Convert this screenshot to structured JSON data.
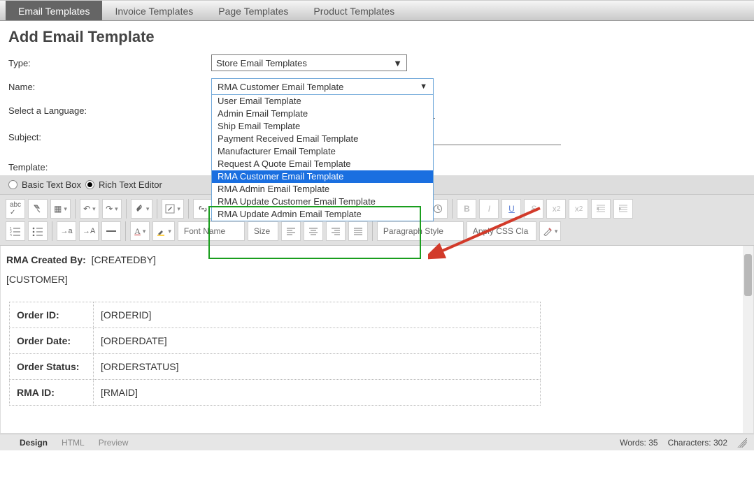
{
  "tabs": {
    "email": "Email Templates",
    "invoice": "Invoice Templates",
    "page": "Page Templates",
    "product": "Product Templates"
  },
  "page_title": "Add Email Template",
  "form": {
    "type_label": "Type:",
    "type_value": "Store Email Templates",
    "name_label": "Name:",
    "name_value": "RMA Customer Email Template",
    "name_options": [
      "User Email Template",
      "Admin Email Template",
      "Ship Email Template",
      "Payment Received Email Template",
      "Manufacturer Email Template",
      "Request A Quote Email Template",
      "RMA Customer Email Template",
      "RMA Admin Email Template",
      "RMA Update Customer Email Template",
      "RMA Update Admin Email Template"
    ],
    "lang_label": "Select a Language:",
    "lang_value": "",
    "subject_label": "Subject:",
    "subject_value": "",
    "template_label": "Template:"
  },
  "editor_mode": {
    "basic": "Basic Text Box",
    "rich": "Rich Text Editor"
  },
  "toolbar": {
    "custom_links": "Custom Links",
    "font_name": "Font Name",
    "font_size": "Size",
    "para_style": "Paragraph Style",
    "css_class": "Apply CSS Cla",
    "bold": "B",
    "italic": "I",
    "underline": "U",
    "strike": "S",
    "sup_base": "x",
    "sup_exp": "2",
    "sub_base": "x",
    "sub_exp": "2",
    "arrow_a1": "→a",
    "arrow_a2": "→A"
  },
  "editor": {
    "line1_label": "RMA Created By:",
    "line1_val": "[CREATEDBY]",
    "line2": "[CUSTOMER]",
    "rows": [
      {
        "k": "Order ID:",
        "v": "[ORDERID]"
      },
      {
        "k": "Order Date:",
        "v": "[ORDERDATE]"
      },
      {
        "k": "Order Status:",
        "v": "[ORDERSTATUS]"
      },
      {
        "k": "RMA ID:",
        "v": "[RMAID]"
      }
    ]
  },
  "bottom": {
    "design": "Design",
    "html": "HTML",
    "preview": "Preview",
    "words_label": "Words:",
    "words": "35",
    "chars_label": "Characters:",
    "chars": "302"
  }
}
